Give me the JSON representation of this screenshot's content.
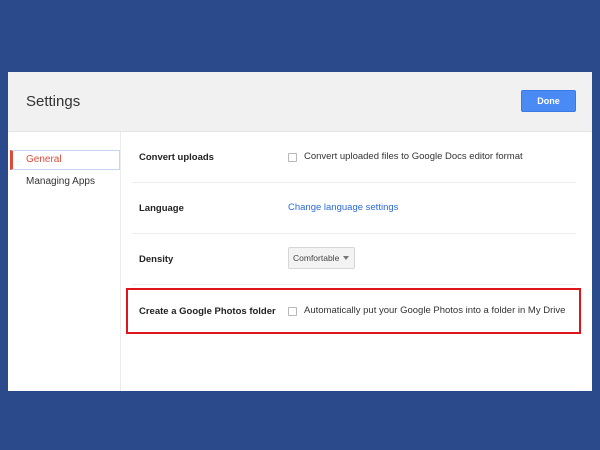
{
  "header": {
    "title": "Settings",
    "done_label": "Done"
  },
  "sidebar": {
    "items": [
      {
        "label": "General",
        "active": true
      },
      {
        "label": "Managing Apps",
        "active": false
      }
    ]
  },
  "settings": {
    "convert_uploads": {
      "label": "Convert uploads",
      "option": "Convert uploaded files to Google Docs editor format",
      "checked": false
    },
    "language": {
      "label": "Language",
      "link": "Change language settings"
    },
    "density": {
      "label": "Density",
      "value": "Comfortable"
    },
    "photos_folder": {
      "label": "Create a Google Photos folder",
      "option": "Automatically put your Google Photos into a folder in My Drive",
      "checked": false
    }
  },
  "colors": {
    "page_bg": "#2a4a8c",
    "primary_button": "#4a8af4",
    "active_nav": "#dd4b39",
    "link": "#2a6ad9",
    "highlight_box": "#e0151b"
  }
}
